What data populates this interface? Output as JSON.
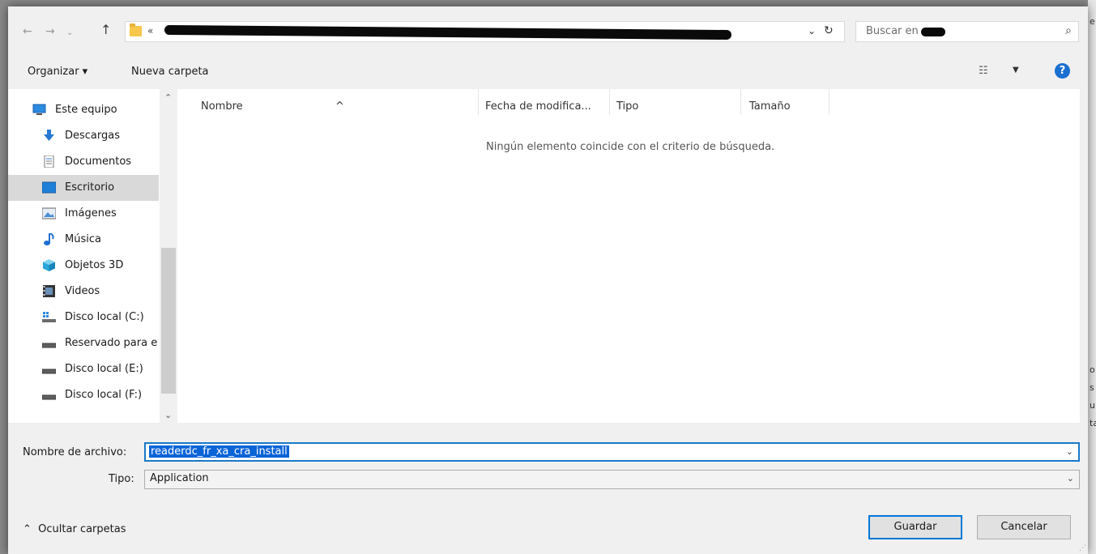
{
  "address": {
    "chevron": "«"
  },
  "search": {
    "placeholder": "Buscar en"
  },
  "toolbar": {
    "organize": "Organizar ▾",
    "new_folder": "Nueva carpeta"
  },
  "sidebar": {
    "items": [
      {
        "label": "Este equipo",
        "icon": "computer-icon"
      },
      {
        "label": "Descargas",
        "icon": "download-icon"
      },
      {
        "label": "Documentos",
        "icon": "document-icon"
      },
      {
        "label": "Escritorio",
        "icon": "desktop-icon",
        "selected": true
      },
      {
        "label": "Imágenes",
        "icon": "pictures-icon"
      },
      {
        "label": "Música",
        "icon": "music-icon"
      },
      {
        "label": "Objetos 3D",
        "icon": "cube-icon"
      },
      {
        "label": "Videos",
        "icon": "video-icon"
      },
      {
        "label": "Disco local (C:)",
        "icon": "drive-icon"
      },
      {
        "label": "Reservado para e",
        "icon": "drive-icon"
      },
      {
        "label": "Disco local (E:)",
        "icon": "drive-icon"
      },
      {
        "label": "Disco local (F:)",
        "icon": "drive-icon"
      }
    ]
  },
  "columns": {
    "name": "Nombre",
    "modified": "Fecha de modifica...",
    "type": "Tipo",
    "size": "Tamaño"
  },
  "empty_message": "Ningún elemento coincide con el criterio de búsqueda.",
  "form": {
    "filename_label": "Nombre de archivo:",
    "filename_value": "readerdc_fr_xa_cra_install",
    "type_label": "Tipo:",
    "type_value": "Application"
  },
  "footer": {
    "hide_folders": "Ocultar carpetas",
    "save": "Guardar",
    "cancel": "Cancelar"
  }
}
